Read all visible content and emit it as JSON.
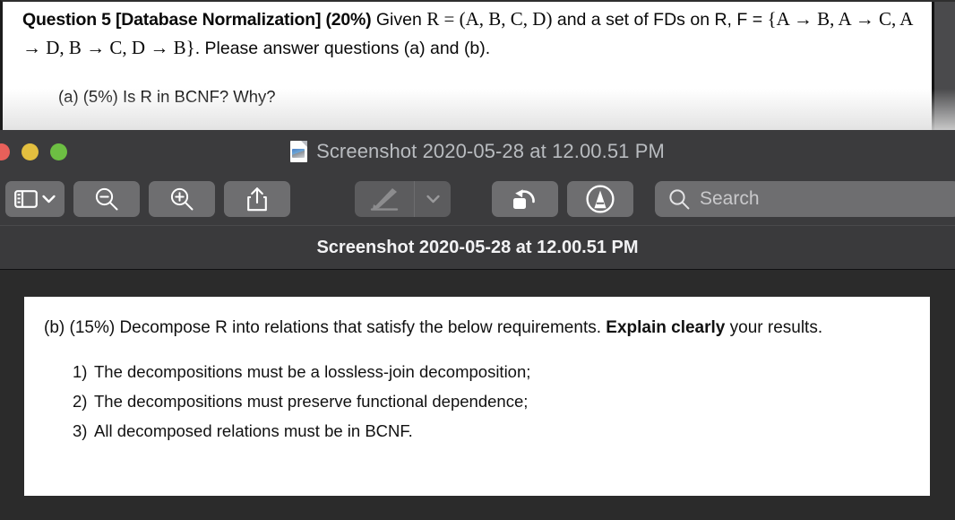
{
  "document_top": {
    "question_title": "Question 5 [Database Normalization] (20%)",
    "intro_part1": " Given ",
    "relation": "R = (A, B, C, D)",
    "intro_part2": " and a set of FDs on R, F =",
    "fd_set": "{A → B, A → C, A → D, B → C, D → B}",
    "intro_part3": ". Please answer questions (a) and (b).",
    "part_a": "(a) (5%) Is R in BCNF? Why?"
  },
  "window": {
    "title": "Screenshot 2020-05-28 at 12.00.51 PM",
    "subtitle": "Screenshot 2020-05-28 at 12.00.51 PM",
    "traffic_lights": [
      {
        "name": "close",
        "color": "#e8605a"
      },
      {
        "name": "minimize",
        "color": "#e3bf3f"
      },
      {
        "name": "zoom",
        "color": "#6dbf43"
      }
    ],
    "toolbar": {
      "sidebar_label": "sidebar-toggle",
      "zoom_out_label": "zoom-out",
      "zoom_in_label": "zoom-in",
      "share_label": "share",
      "markup_label": "markup",
      "markup_menu_label": "markup-options",
      "rotate_label": "rotate-left",
      "annotate_label": "annotate",
      "search_placeholder": "Search",
      "search_value": ""
    }
  },
  "content": {
    "part_b_pre": "(b) (15%) Decompose R into relations that satisfy the below requirements. ",
    "part_b_bold": "Explain clearly",
    "part_b_post": " your results.",
    "requirements": [
      {
        "num": "1)",
        "text": "The decompositions must be a lossless-join decomposition;"
      },
      {
        "num": "2)",
        "text": "The decompositions must preserve functional dependence;"
      },
      {
        "num": "3)",
        "text": "All decomposed relations must be in BCNF."
      }
    ]
  }
}
